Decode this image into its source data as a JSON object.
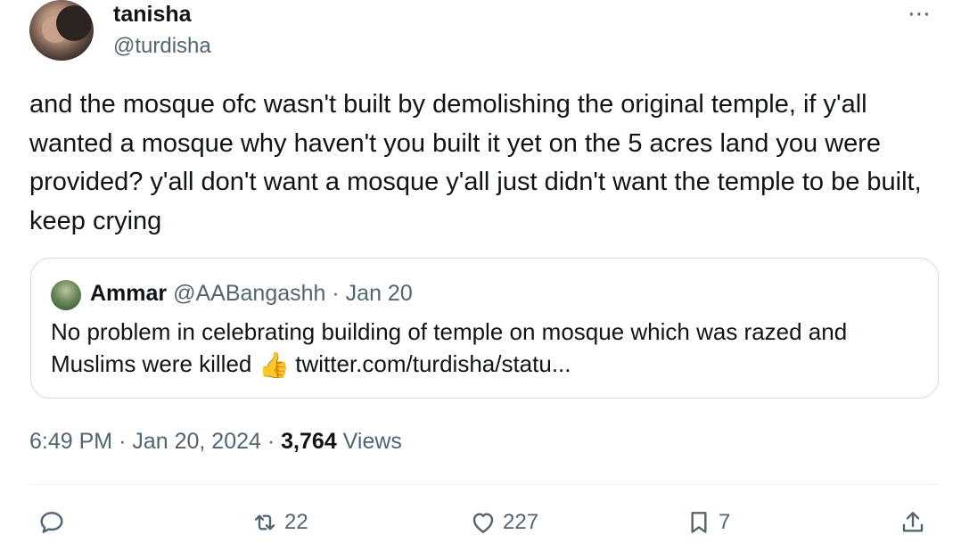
{
  "author": {
    "name": "tanisha",
    "handle": "@turdisha"
  },
  "more_icon": "⋯",
  "tweet": {
    "text": "and the mosque ofc wasn't built by demolishing the original temple, if y'all wanted a mosque why haven't you built it yet on the 5 acres land you were provided? y'all don't want a mosque y'all just didn't want the temple to be built, keep crying"
  },
  "quote": {
    "name": "Ammar",
    "handle": "@AABangashh",
    "separator": "·",
    "date": "Jan 20",
    "text_before": "No problem in celebrating building of temple on mosque which was razed and Muslims were killed",
    "emoji": "👍",
    "link": "twitter.com/turdisha/statu..."
  },
  "meta": {
    "time": "6:49 PM",
    "sep1": "·",
    "date": "Jan 20, 2024",
    "sep2": "·",
    "views_count": "3,764",
    "views_label": "Views"
  },
  "actions": {
    "reply": {
      "icon": "reply-icon",
      "count": ""
    },
    "retweet": {
      "icon": "retweet-icon",
      "count": "22"
    },
    "like": {
      "icon": "heart-icon",
      "count": "227"
    },
    "bookmark": {
      "icon": "bookmark-icon",
      "count": "7"
    },
    "share": {
      "icon": "share-icon",
      "count": ""
    }
  },
  "colors": {
    "text": "#0f1419",
    "secondary": "#536471",
    "border": "#cfd9de"
  }
}
